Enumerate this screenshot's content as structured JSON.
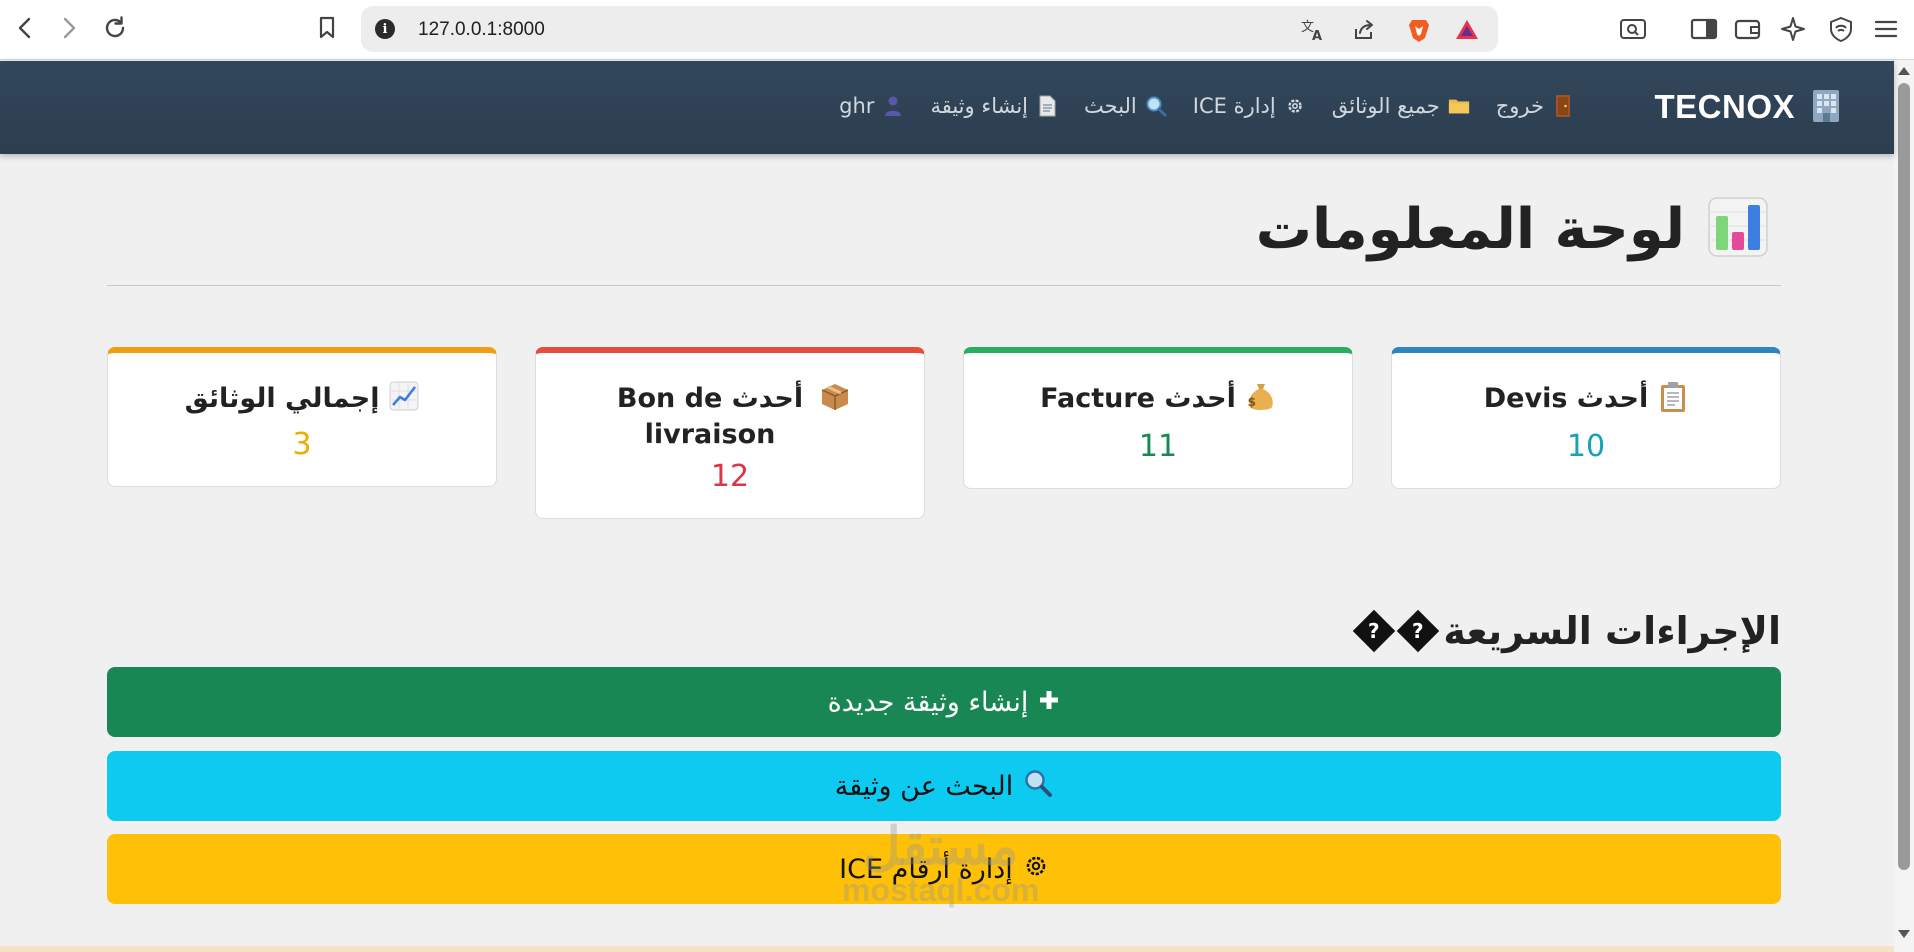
{
  "browser": {
    "url": "127.0.0.1:8000"
  },
  "navbar": {
    "brand": "TECNOX",
    "links": [
      {
        "label": "ghr",
        "icon": "user-icon"
      },
      {
        "label": "إنشاء وثيقة",
        "icon": "document-icon"
      },
      {
        "label": "البحث",
        "icon": "search-icon"
      },
      {
        "label": "إدارة ICE",
        "icon": "gear-icon"
      },
      {
        "label": "جميع الوثائق",
        "icon": "folder-icon"
      },
      {
        "label": "خروج",
        "icon": "door-icon"
      }
    ]
  },
  "page": {
    "title": "لوحة المعلومات"
  },
  "stats": [
    {
      "label": "أحدث Devis",
      "value": "10",
      "icon": "clipboard-icon",
      "accent": "#2e86c1",
      "value_color": "#17a2b8"
    },
    {
      "label": "أحدث Facture",
      "value": "11",
      "icon": "money-bag-icon",
      "accent": "#27ae60",
      "value_color": "#198754"
    },
    {
      "label": "أحدث Bon de livraison",
      "value": "12",
      "icon": "package-icon",
      "accent": "#e74c3c",
      "value_color": "#dc3545"
    },
    {
      "label": "إجمالي الوثائق",
      "value": "3",
      "icon": "chart-up-icon",
      "accent": "#f39c12",
      "value_color": "#f0ad00"
    }
  ],
  "quick_actions": {
    "title": "الإجراءات السريعة",
    "buttons": [
      {
        "label": "إنشاء وثيقة جديدة",
        "icon": "plus-icon",
        "bg": "#198754",
        "fg": "#ffffff"
      },
      {
        "label": "البحث عن وثيقة",
        "icon": "search-icon",
        "bg": "#0dcaf0",
        "fg": "#111111"
      },
      {
        "label": "إدارة أرقام ICE",
        "icon": "gear-icon",
        "bg": "#ffc107",
        "fg": "#111111"
      }
    ]
  },
  "watermark": {
    "text_ar": "مستقل",
    "text_en": "mostaql.com"
  }
}
